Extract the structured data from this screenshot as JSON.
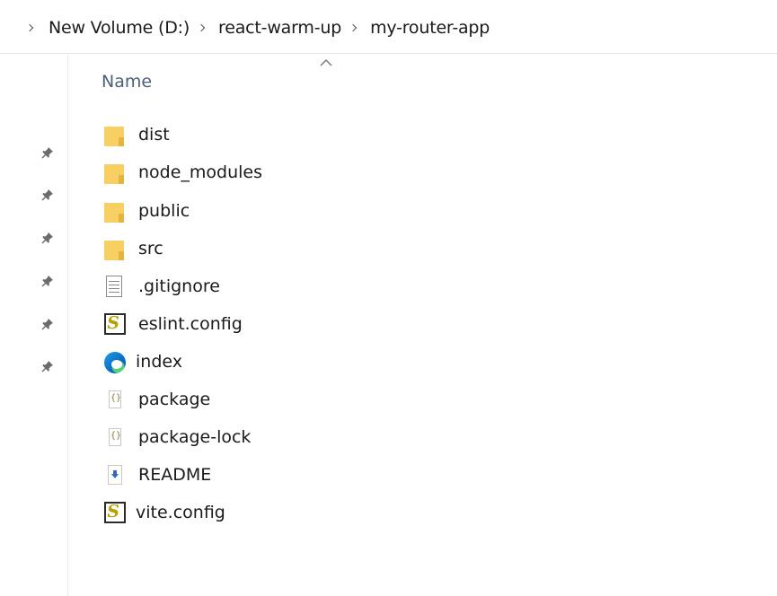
{
  "breadcrumb": {
    "items": [
      "New Volume (D:)",
      "react-warm-up",
      "my-router-app"
    ]
  },
  "list": {
    "column_header": "Name",
    "sort_indicator": "ascending",
    "files": [
      {
        "name": "dist",
        "icon": "folder-icon"
      },
      {
        "name": "node_modules",
        "icon": "folder-icon"
      },
      {
        "name": "public",
        "icon": "folder-icon"
      },
      {
        "name": "src",
        "icon": "folder-icon"
      },
      {
        "name": ".gitignore",
        "icon": "text-file-icon"
      },
      {
        "name": "eslint.config",
        "icon": "script-file-icon"
      },
      {
        "name": "index",
        "icon": "edge-html-icon"
      },
      {
        "name": "package",
        "icon": "json-file-icon"
      },
      {
        "name": "package-lock",
        "icon": "json-file-icon"
      },
      {
        "name": "README",
        "icon": "markdown-file-icon"
      },
      {
        "name": "vite.config",
        "icon": "script-file-icon"
      }
    ]
  },
  "quick_access": {
    "pinned_count": 6
  },
  "colors": {
    "folder": "#f7cf62",
    "header_text": "#4c607a"
  }
}
